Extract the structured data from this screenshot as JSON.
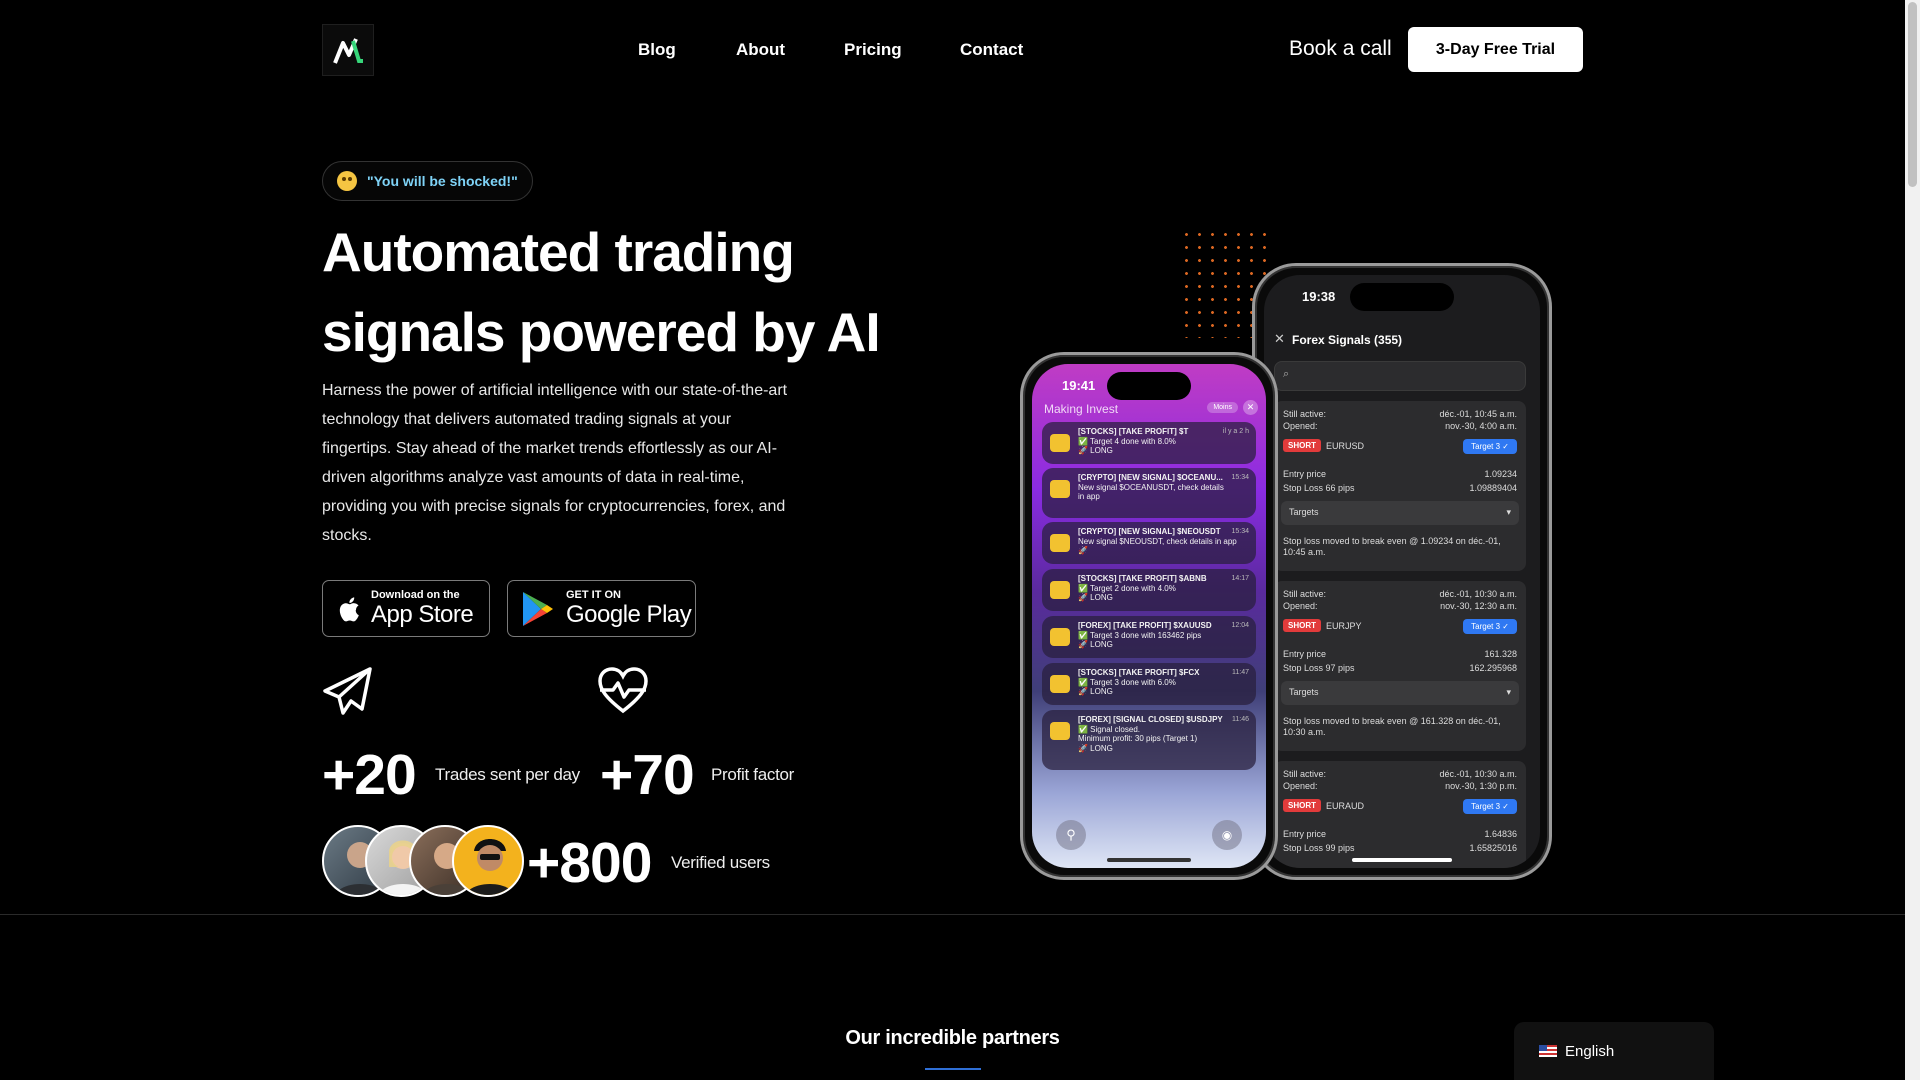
{
  "header": {
    "nav": [
      "Blog",
      "About",
      "Pricing",
      "Contact"
    ],
    "book_call": "Book a call",
    "trial_button": "3-Day Free Trial"
  },
  "hero": {
    "badge_text": "\"You will be shocked!\"",
    "title_line1": "Automated trading",
    "title_line2": "signals powered by AI",
    "description": "Harness the power of artificial intelligence with our state-of-the-art technology that delivers automated trading signals at your fingertips. Stay ahead of the market trends effortlessly as our AI-driven algorithms analyze vast amounts of data in real-time, providing you with precise signals for cryptocurrencies, forex, and stocks.",
    "app_store": {
      "small": "Download on the",
      "big": "App Store"
    },
    "google_play": {
      "small": "GET IT ON",
      "big": "Google Play"
    },
    "stats": [
      {
        "value": "+20",
        "label": "Trades sent per day",
        "icon": "paper-plane-icon"
      },
      {
        "value": "+70",
        "label": "Profit factor",
        "icon": "heart-pulse-icon"
      }
    ],
    "users": {
      "value": "+800",
      "label": "Verified users"
    }
  },
  "phone_back": {
    "time": "19:38",
    "title": "Forex Signals (355)",
    "cards": [
      {
        "active_label": "Still active:",
        "active": "déc.-01, 10:45 a.m.",
        "opened_label": "Opened:",
        "opened": "nov.-30, 4:00 a.m.",
        "side": "SHORT",
        "pair": "EURUSD",
        "target": "Target 3 ✓",
        "entry_label": "Entry price",
        "entry": "1.09234",
        "sl_label": "Stop Loss 66 pips",
        "sl": "1.09889404",
        "targets": "Targets",
        "note": "Stop loss moved to break even @ 1.09234 on déc.-01, 10:45 a.m."
      },
      {
        "active_label": "Still active:",
        "active": "déc.-01, 10:30 a.m.",
        "opened_label": "Opened:",
        "opened": "nov.-30, 12:30 a.m.",
        "side": "SHORT",
        "pair": "EURJPY",
        "target": "Target 3 ✓",
        "entry_label": "Entry price",
        "entry": "161.328",
        "sl_label": "Stop Loss 97 pips",
        "sl": "162.295968",
        "targets": "Targets",
        "note": "Stop loss moved to break even @ 161.328 on déc.-01, 10:30 a.m."
      },
      {
        "active_label": "Still active:",
        "active": "déc.-01, 10:30 a.m.",
        "opened_label": "Opened:",
        "opened": "nov.-30, 1:30 p.m.",
        "side": "SHORT",
        "pair": "EURAUD",
        "target": "Target 3 ✓",
        "entry_label": "Entry price",
        "entry": "1.64836",
        "sl_label": "Stop Loss 99 pips",
        "sl": "1.65825016"
      }
    ]
  },
  "phone_front": {
    "time": "19:41",
    "app": "Making Invest",
    "pill": "Moins",
    "notifications": [
      {
        "title": "[STOCKS] [TAKE PROFIT] $T",
        "line1": "✅ Target 4 done with 8.0%",
        "line2": "🚀 LONG",
        "time": "il y a 2 h"
      },
      {
        "title": "[CRYPTO] [NEW SIGNAL] $OCEANU...",
        "line1": "New signal $OCEANUSDT, check details",
        "line2": "in app",
        "time": "15:34"
      },
      {
        "title": "[CRYPTO] [NEW SIGNAL] $NEOUSDT",
        "line1": "New signal $NEOUSDT, check details in app",
        "line2": "🚀",
        "time": "15:34"
      },
      {
        "title": "[STOCKS] [TAKE PROFIT] $ABNB",
        "line1": "✅ Target 2 done with 4.0%",
        "line2": "🚀 LONG",
        "time": "14:17"
      },
      {
        "title": "[FOREX] [TAKE PROFIT] $XAUUSD",
        "line1": "✅ Target 3 done with 163462 pips",
        "line2": "🚀 LONG",
        "time": "12:04"
      },
      {
        "title": "[STOCKS] [TAKE PROFIT] $FCX",
        "line1": "✅ Target 3 done with 6.0%",
        "line2": "🚀 LONG",
        "time": "11:47"
      },
      {
        "title": "[FOREX] [SIGNAL CLOSED] $USDJPY",
        "line1": "✅ Signal closed.",
        "line2": "Minimum profit: 30 pips (Target 1)",
        "line3": "🚀 LONG",
        "time": "11:46"
      }
    ]
  },
  "partners_title": "Our incredible partners",
  "language": "English"
}
